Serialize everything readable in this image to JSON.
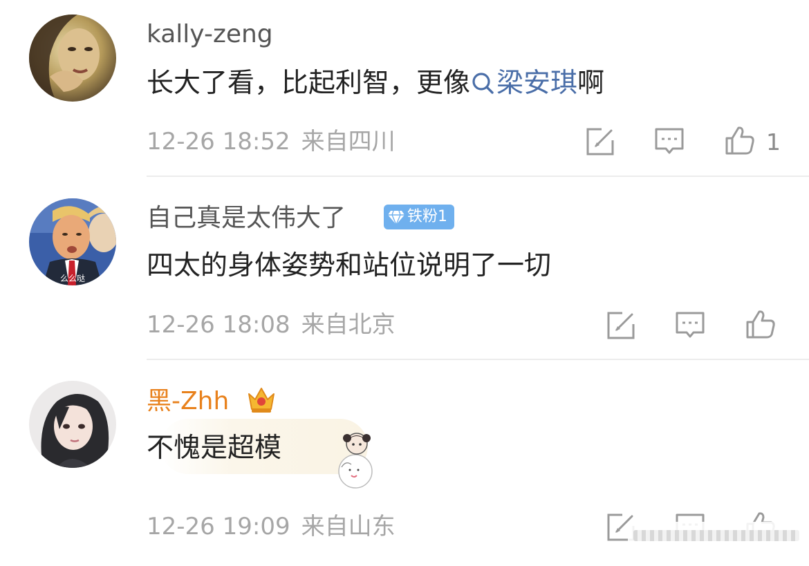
{
  "comments": [
    {
      "username": "kally-zeng",
      "text_prefix": "长大了看，比起利智，更像",
      "topic": "梁安琪",
      "text_suffix": "啊",
      "time": "12-26 18:52",
      "location": "来自四川",
      "like_count": "1"
    },
    {
      "username": "自己真是太伟大了",
      "badge": "铁粉1",
      "avatar_caption": "么么哒",
      "text": "四太的身体姿势和站位说明了一切",
      "time": "12-26 18:08",
      "location": "来自北京"
    },
    {
      "username": "黑-Zhh",
      "text": "不愧是超模",
      "time": "12-26 19:09",
      "location": "来自山东"
    }
  ],
  "colors": {
    "vip_name": "#e8811c",
    "topic_link": "#4a6ea8",
    "meta_gray": "#a6a6a6",
    "badge_blue": "#6fb0ee"
  },
  "icons": [
    "edit-icon",
    "comment-icon",
    "thumbs-up-icon",
    "search-icon",
    "diamond-icon",
    "crown-icon"
  ]
}
